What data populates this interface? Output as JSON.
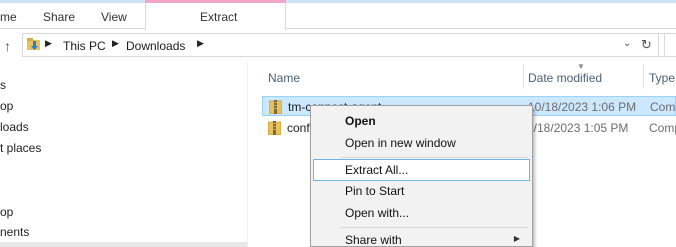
{
  "ribbon": {
    "tabs": [
      "me",
      "Share",
      "View"
    ],
    "contextual_tab": "Extract"
  },
  "address": {
    "crumbs": [
      "This PC",
      "Downloads"
    ]
  },
  "nav_pane": {
    "items": [
      "s",
      "op",
      "loads",
      "t places",
      "op",
      "nents"
    ]
  },
  "columns": {
    "name": "Name",
    "date_modified": "Date modified",
    "type": "Type"
  },
  "files": [
    {
      "name": "tm-connect-agent",
      "date": "10/18/2023 1:06 PM",
      "type": "Comp",
      "selected": true
    },
    {
      "name": "conf",
      "date": "0/18/2023 1:05 PM",
      "type": "Comp",
      "selected": false
    }
  ],
  "context_menu": {
    "items": [
      {
        "label": "Open",
        "bold": true
      },
      {
        "label": "Open in new window"
      },
      {
        "label": "Extract All...",
        "hover": true
      },
      {
        "label": "Pin to Start"
      },
      {
        "label": "Open with..."
      },
      {
        "label": "Share with",
        "submenu": true
      }
    ]
  },
  "colors": {
    "selection_bg": "#cce8ff",
    "selection_border": "#99d1ff",
    "menu_bg": "#f2f2f2",
    "menu_hover_border": "#6fb4e6",
    "contextual_tab_accent": "#f3a5c8"
  }
}
